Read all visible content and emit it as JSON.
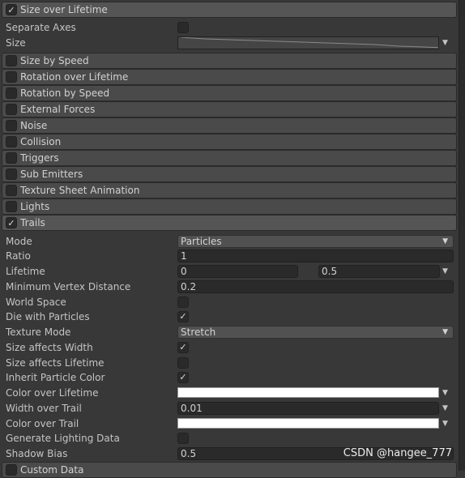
{
  "size_over_lifetime": {
    "label": "Size over Lifetime",
    "enabled": true,
    "separate_axes": {
      "label": "Separate Axes",
      "checked": false
    },
    "size": {
      "label": "Size"
    }
  },
  "modules": [
    {
      "label": "Size by Speed",
      "enabled": false
    },
    {
      "label": "Rotation over Lifetime",
      "enabled": false
    },
    {
      "label": "Rotation by Speed",
      "enabled": false
    },
    {
      "label": "External Forces",
      "enabled": false
    },
    {
      "label": "Noise",
      "enabled": false
    },
    {
      "label": "Collision",
      "enabled": false
    },
    {
      "label": "Triggers",
      "enabled": false
    },
    {
      "label": "Sub Emitters",
      "enabled": false
    },
    {
      "label": "Texture Sheet Animation",
      "enabled": false
    },
    {
      "label": "Lights",
      "enabled": false
    }
  ],
  "trails": {
    "label": "Trails",
    "enabled": true,
    "mode": {
      "label": "Mode",
      "value": "Particles"
    },
    "ratio": {
      "label": "Ratio",
      "value": "1"
    },
    "lifetime": {
      "label": "Lifetime",
      "min": "0",
      "max": "0.5"
    },
    "min_vertex_distance": {
      "label": "Minimum Vertex Distance",
      "value": "0.2"
    },
    "world_space": {
      "label": "World Space",
      "checked": false
    },
    "die_with_particles": {
      "label": "Die with Particles",
      "checked": true
    },
    "texture_mode": {
      "label": "Texture Mode",
      "value": "Stretch"
    },
    "size_affects_width": {
      "label": "Size affects Width",
      "checked": true
    },
    "size_affects_lifetime": {
      "label": "Size affects Lifetime",
      "checked": false
    },
    "inherit_particle_color": {
      "label": "Inherit Particle Color",
      "checked": true
    },
    "color_over_lifetime": {
      "label": "Color over Lifetime",
      "color": "#ffffff"
    },
    "width_over_trail": {
      "label": "Width over Trail",
      "value": "0.01"
    },
    "color_over_trail": {
      "label": "Color over Trail",
      "color": "#ffffff"
    },
    "generate_lighting_data": {
      "label": "Generate Lighting Data",
      "checked": false
    },
    "shadow_bias": {
      "label": "Shadow Bias",
      "value": "0.5"
    }
  },
  "custom_data": {
    "label": "Custom Data",
    "enabled": false
  },
  "watermark": "CSDN @hangee_777",
  "icons": {
    "check": "✓",
    "dropdown": "▼"
  }
}
